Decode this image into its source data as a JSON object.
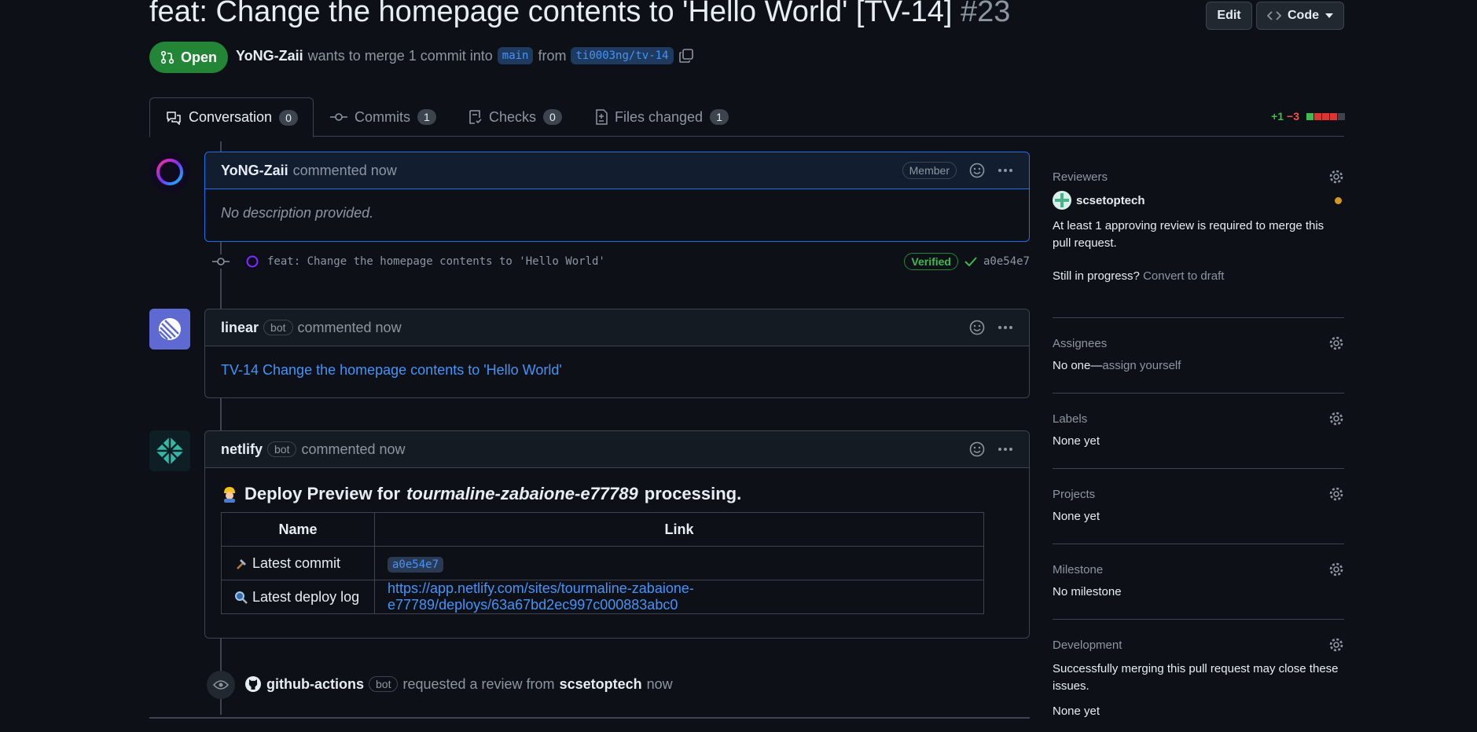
{
  "pr": {
    "title": "feat: Change the homepage contents to 'Hello World' [TV-14]",
    "number": "#23",
    "state": "Open",
    "author": "YoNG-Zaii",
    "merge_text": "wants to merge 1 commit into",
    "base_branch": "main",
    "from_text": "from",
    "head_branch": "ti0003ng/tv-14"
  },
  "header_buttons": {
    "edit": "Edit",
    "code": "Code"
  },
  "tabs": [
    {
      "label": "Conversation",
      "count": "0"
    },
    {
      "label": "Commits",
      "count": "1"
    },
    {
      "label": "Checks",
      "count": "0"
    },
    {
      "label": "Files changed",
      "count": "1"
    }
  ],
  "diffstat": {
    "additions": "+1",
    "deletions": "−3"
  },
  "comments": {
    "c1": {
      "author": "YoNG-Zaii",
      "action": "commented now",
      "badge": "Member",
      "body": "No description provided."
    },
    "commit": {
      "message": "feat: Change the homepage contents to 'Hello World'",
      "verified": "Verified",
      "sha": "a0e54e7"
    },
    "c2": {
      "author": "linear",
      "bot": "bot",
      "action": "commented now",
      "link": "TV-14 Change the homepage contents to 'Hello World'"
    },
    "c3": {
      "author": "netlify",
      "bot": "bot",
      "action": "commented now",
      "heading_pre": "Deploy Preview for",
      "heading_site": "tourmaline-zabaione-e77789",
      "heading_post": "processing.",
      "table_headers": [
        "Name",
        "Link"
      ],
      "row1_name": "Latest commit",
      "row1_value": "a0e54e7",
      "row2_name": "Latest deploy log",
      "row2_value": "https://app.netlify.com/sites/tourmaline-zabaione-e77789/deploys/63a67bd2ec997c000883abc0"
    },
    "event": {
      "actor": "github-actions",
      "bot": "bot",
      "action": "requested a review from",
      "target": "scsetoptech",
      "time": "now"
    }
  },
  "sidebar": {
    "reviewers": {
      "title": "Reviewers",
      "name": "scsetoptech",
      "note": "At least 1 approving review is required to merge this pull request.",
      "draft_q": "Still in progress?",
      "draft_link": "Convert to draft"
    },
    "assignees": {
      "title": "Assignees",
      "none": "No one—",
      "assign": "assign yourself"
    },
    "labels": {
      "title": "Labels",
      "value": "None yet"
    },
    "projects": {
      "title": "Projects",
      "value": "None yet"
    },
    "milestone": {
      "title": "Milestone",
      "value": "No milestone"
    },
    "development": {
      "title": "Development",
      "note": "Successfully merging this pull request may close these issues.",
      "value": "None yet"
    }
  },
  "colors": {
    "open": "#238636",
    "link": "#4493f8",
    "bg": "#0d1117"
  }
}
